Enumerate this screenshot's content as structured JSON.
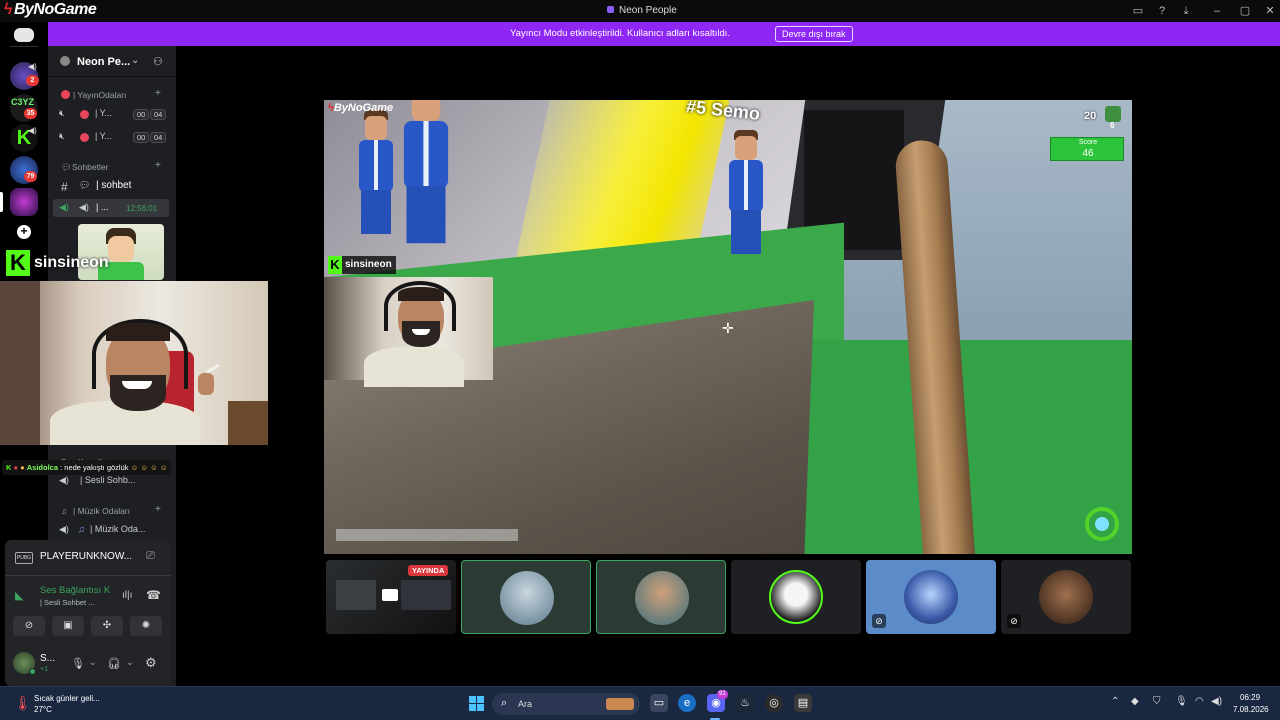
{
  "app": {
    "brand": "ByNoGame",
    "window_title": "Neon People",
    "accent": "#8e27f4"
  },
  "banner": {
    "text": "Yayıncı Modu etkinleştirildi. Kullanıcı adları kısaltıldı.",
    "button": "Devre dışı bırak"
  },
  "server_rail": {
    "badges": [
      "2",
      "35",
      "79"
    ],
    "server_labels": [
      "C3YZ"
    ]
  },
  "sidebar": {
    "server_name": "Neon Pe...",
    "categories": {
      "stream_rooms": "| YayınOdaları",
      "chats": "Sohbetler",
      "voice": "Ses Kanalları",
      "music": "| Müzik Odaları"
    },
    "stream_channels": [
      {
        "label": "| Y...",
        "a": "00",
        "b": "04"
      },
      {
        "label": "| Y...",
        "a": "00",
        "b": "04"
      }
    ],
    "chat_channel": "| sohbet",
    "active_voice": {
      "label": "| ...",
      "time": "12:56:01"
    },
    "voice_channel": "| Sesli Sohb...",
    "music_channel": "| Müzik Oda..."
  },
  "stream_overlay": {
    "streamer": "sinsineon",
    "chat_user": "Asidolca",
    "chat_text": ": nede yakıştı gözlük"
  },
  "game": {
    "logo": "ByNoGame",
    "player_tag": "#5 Semo",
    "count": "20",
    "small_count": "6",
    "score_label": "Score",
    "score_value": "46",
    "streamer_tag": "sinsineon"
  },
  "tiles": {
    "live_badge": "YAYINDA"
  },
  "user_panel": {
    "activity": "PLAYERUNKNOW...",
    "voice_status": "Ses Bağlantısı K",
    "voice_channel": "| Sesli Sohbet ...",
    "username": "S...",
    "username_sub": "+1"
  },
  "taskbar": {
    "weather_line1": "Sıcak günler geli...",
    "weather_line2": "27°C",
    "search_placeholder": "Ara",
    "discord_badge": "91",
    "time": "06:29",
    "date": "7.08.2026"
  }
}
